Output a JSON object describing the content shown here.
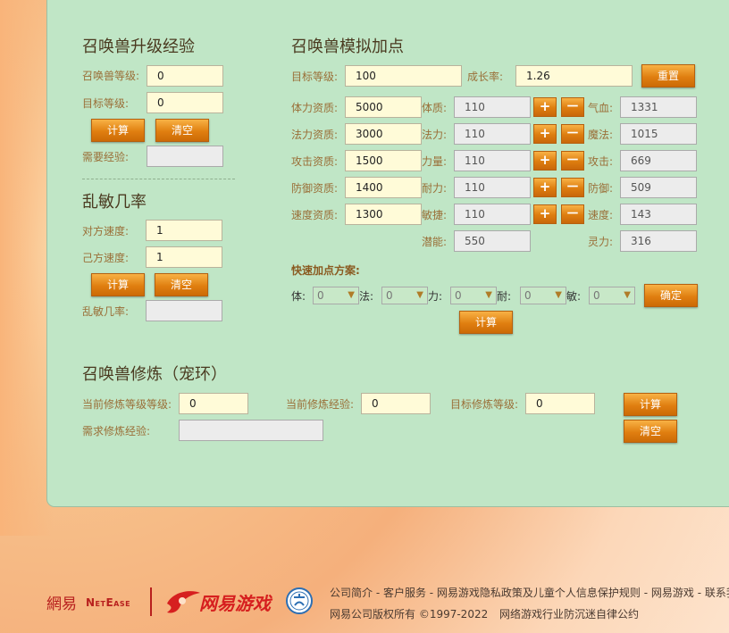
{
  "upgrade": {
    "title": "召唤兽升级经验",
    "level_label": "召唤兽等级:",
    "level_value": "0",
    "target_label": "目标等级:",
    "target_value": "0",
    "calc_label": "计算",
    "clear_label": "清空",
    "need_exp_label": "需要经验:",
    "need_exp_value": ""
  },
  "luanmin": {
    "title": "乱敏几率",
    "enemy_speed_label": "对方速度:",
    "enemy_speed_value": "1",
    "self_speed_label": "己方速度:",
    "self_speed_value": "1",
    "calc_label": "计算",
    "clear_label": "清空",
    "result_label": "乱敏几率:",
    "result_value": ""
  },
  "simulate": {
    "title": "召唤兽模拟加点",
    "target_level_label": "目标等级:",
    "target_level_value": "100",
    "growth_label": "成长率:",
    "growth_value": "1.26",
    "reset_label": "重置",
    "plus": "+",
    "minus": "－",
    "rows": [
      {
        "apt_label": "体力资质:",
        "apt_value": "5000",
        "stat_label": "体质:",
        "stat_value": "110",
        "res_label": "气血:",
        "res_value": "1331"
      },
      {
        "apt_label": "法力资质:",
        "apt_value": "3000",
        "stat_label": "法力:",
        "stat_value": "110",
        "res_label": "魔法:",
        "res_value": "1015"
      },
      {
        "apt_label": "攻击资质:",
        "apt_value": "1500",
        "stat_label": "力量:",
        "stat_value": "110",
        "res_label": "攻击:",
        "res_value": "669"
      },
      {
        "apt_label": "防御资质:",
        "apt_value": "1400",
        "stat_label": "耐力:",
        "stat_value": "110",
        "res_label": "防御:",
        "res_value": "509"
      },
      {
        "apt_label": "速度资质:",
        "apt_value": "1300",
        "stat_label": "敏捷:",
        "stat_value": "110",
        "res_label": "速度:",
        "res_value": "143"
      }
    ],
    "potential_label": "潜能:",
    "potential_value": "550",
    "spirit_label": "灵力:",
    "spirit_value": "316",
    "quick_title": "快速加点方案:",
    "quick": [
      {
        "label": "体:",
        "value": "0"
      },
      {
        "label": "法:",
        "value": "0"
      },
      {
        "label": "力:",
        "value": "0"
      },
      {
        "label": "耐:",
        "value": "0"
      },
      {
        "label": "敏:",
        "value": "0"
      }
    ],
    "confirm_label": "确定",
    "calc_label": "计算"
  },
  "cultivation": {
    "title": "召唤兽修炼（宠环）",
    "current_level_label": "当前修炼等级等级:",
    "current_level_value": "0",
    "current_exp_label": "当前修炼经验:",
    "current_exp_value": "0",
    "target_level_label": "目标修炼等级:",
    "target_level_value": "0",
    "need_exp_label": "需求修炼经验:",
    "need_exp_value": "",
    "calc_label": "计算",
    "clear_label": "清空"
  },
  "footer": {
    "netease_cn": "網易",
    "netease_en": "NetEase",
    "games_logo": "网易游戏",
    "links": "公司简介 - 客户服务 - 网易游戏隐私政策及儿童个人信息保护规则 - 网易游戏 - 联系我们",
    "copyright": "网易公司版权所有 ©1997-2022",
    "self_discipline": "网络游戏行业防沉迷自律公约",
    "badge_icon": "culture-badge-icon"
  },
  "colors": {
    "panel_bg": "#c0e6c6",
    "button_orange": "#e07f10",
    "label_brown": "#9a6f38"
  }
}
